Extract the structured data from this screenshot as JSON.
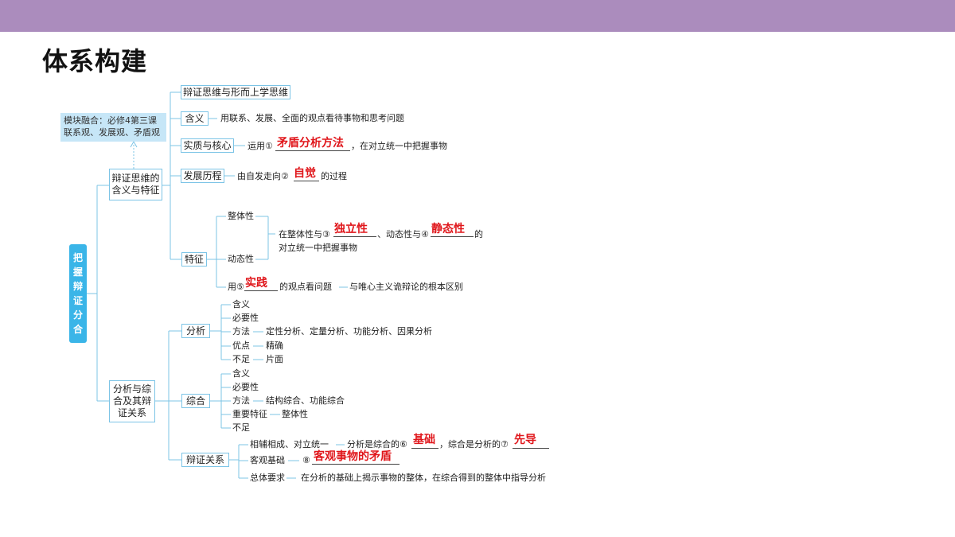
{
  "title": "体系构建",
  "root": [
    "把",
    "握",
    "辩",
    "证",
    "分",
    "合"
  ],
  "note": {
    "line1": "模块融合：必修4第三课",
    "line2": "联系观、发展观、矛盾观"
  },
  "branch1": {
    "label_line1": "辩证思维的",
    "label_line2": "含义与特征",
    "thinking": "辩证思维与形而上学思维",
    "meaning": {
      "label": "含义",
      "text": "用联系、发展、全面的观点看待事物和思考问题"
    },
    "essence": {
      "label": "实质与核心",
      "prefix": "运用①",
      "answer": "矛盾分析方法",
      "suffix": "，在对立统一中把握事物"
    },
    "history": {
      "label": "发展历程",
      "prefix": "由自发走向②",
      "answer": "自觉",
      "suffix": "的过程"
    },
    "features": {
      "label": "特征",
      "whole": "整体性",
      "dynamic": "动态性",
      "line1_prefix": "在整体性与③",
      "answer3": "独立性",
      "line1_mid": "、动态性与④",
      "answer4": "静态性",
      "line1_suffix": "的",
      "line2": "对立统一中把握事物",
      "practice_prefix": "用⑤",
      "answer5": "实践",
      "practice_suffix": "的观点看问题",
      "practice_tail": "与唯心主义诡辩论的根本区别"
    }
  },
  "branch2": {
    "label_line1": "分析与综",
    "label_line2": "合及其辩",
    "label_line3": "证关系",
    "analysis": {
      "label": "分析",
      "meaning": "含义",
      "necessity": "必要性",
      "method": "方法",
      "method_text": "定性分析、定量分析、功能分析、因果分析",
      "merit": "优点",
      "merit_text": "精确",
      "flaw": "不足",
      "flaw_text": "片面"
    },
    "synthesis": {
      "label": "综合",
      "meaning": "含义",
      "necessity": "必要性",
      "method": "方法",
      "method_text": "结构综合、功能综合",
      "feature": "重要特征",
      "feature_text": "整体性",
      "flaw": "不足"
    },
    "relation": {
      "label": "辩证关系",
      "item1": "相辅相成、对立统一",
      "item1_prefix": "分析是综合的⑥",
      "answer6": "基础",
      "item1_mid": "，综合是分析的⑦",
      "answer7": "先导",
      "item2": "客观基础",
      "item2_prefix": "⑧",
      "answer8": "客观事物的矛盾",
      "item3": "总体要求",
      "item3_text": "在分析的基础上揭示事物的整体，在综合得到的整体中指导分析"
    }
  },
  "colors": {
    "topbar": "#ab8cbd",
    "root": "#3ab5e8",
    "box_border": "#7cc4e6",
    "note_bg": "#c6e6f7",
    "answer": "#e0161b",
    "line": "#7cc4e6"
  }
}
